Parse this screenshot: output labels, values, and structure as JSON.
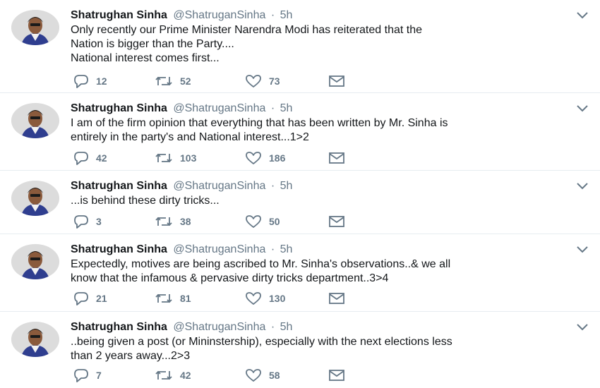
{
  "tweets": [
    {
      "name": "Shatrughan Sinha",
      "handle": "@ShatruganSinha",
      "separator": "·",
      "time": "5h",
      "lines": [
        "Only recently our Prime Minister Narendra Modi has reiterated that the",
        "Nation is bigger than the Party....",
        "National interest comes first..."
      ],
      "replies": "12",
      "retweets": "52",
      "likes": "73"
    },
    {
      "name": "Shatrughan Sinha",
      "handle": "@ShatruganSinha",
      "separator": "·",
      "time": "5h",
      "lines": [
        "I am of the firm opinion that everything that has been written by Mr. Sinha is",
        "entirely in the party's and National interest...1>2"
      ],
      "replies": "42",
      "retweets": "103",
      "likes": "186"
    },
    {
      "name": "Shatrughan Sinha",
      "handle": "@ShatruganSinha",
      "separator": "·",
      "time": "5h",
      "lines": [
        "...is behind these dirty tricks..."
      ],
      "replies": "3",
      "retweets": "38",
      "likes": "50"
    },
    {
      "name": "Shatrughan Sinha",
      "handle": "@ShatruganSinha",
      "separator": "·",
      "time": "5h",
      "lines": [
        "Expectedly, motives are being ascribed to Mr. Sinha's observations..& we all",
        "know that the infamous & pervasive dirty tricks department..3>4"
      ],
      "replies": "21",
      "retweets": "81",
      "likes": "130"
    },
    {
      "name": "Shatrughan Sinha",
      "handle": "@ShatruganSinha",
      "separator": "·",
      "time": "5h",
      "lines": [
        "..being given a post (or Mininstership), especially with the next elections less",
        "than 2 years away...2>3"
      ],
      "replies": "7",
      "retweets": "42",
      "likes": "58"
    }
  ],
  "icons": {
    "reply": "reply-icon",
    "retweet": "retweet-icon",
    "like": "heart-icon",
    "message": "envelope-icon",
    "menu": "chevron-down-icon",
    "avatar": "avatar"
  },
  "colors": {
    "text": "#14171a",
    "muted": "#657786",
    "icon": "#657786",
    "divider": "#e6ecf0"
  }
}
